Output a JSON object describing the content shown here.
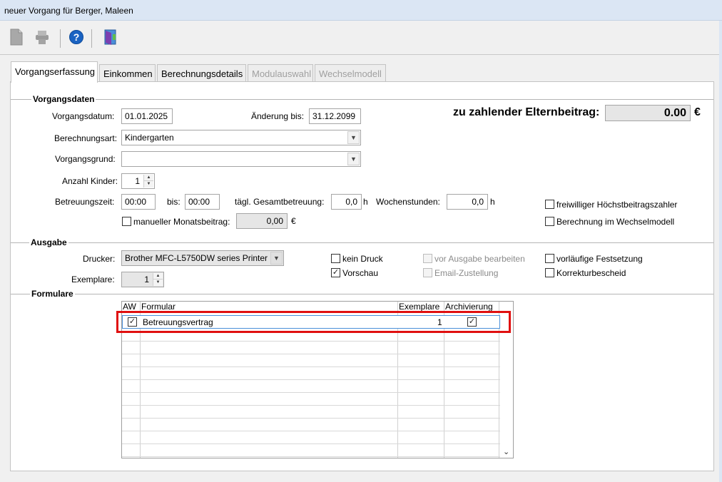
{
  "window": {
    "title": "neuer Vorgang für Berger, Maleen"
  },
  "toolbar": {
    "icons": [
      "new-document-icon",
      "print-icon",
      "help-icon",
      "exit-door-icon"
    ],
    "help_glyph": "?"
  },
  "tabs": [
    {
      "label": "Vorgangserfassung",
      "state": "active"
    },
    {
      "label": "Einkommen",
      "state": "normal"
    },
    {
      "label": "Berechnungsdetails",
      "state": "normal"
    },
    {
      "label": "Modulauswahl",
      "state": "disabled"
    },
    {
      "label": "Wechselmodell",
      "state": "disabled"
    }
  ],
  "vorgangsdaten": {
    "section_title": "Vorgangsdaten",
    "vorgangsdatum_label": "Vorgangsdatum:",
    "vorgangsdatum_value": "01.01.2025",
    "aenderung_label": "Änderung bis:",
    "aenderung_value": "31.12.2099",
    "beitrag_label": "zu zahlender Elternbeitrag:",
    "beitrag_value": "0.00",
    "beitrag_currency": "€",
    "berechnungsart_label": "Berechnungsart:",
    "berechnungsart_value": "Kindergarten",
    "vorgangsgrund_label": "Vorgangsgrund:",
    "vorgangsgrund_value": "",
    "anzahl_kinder_label": "Anzahl Kinder:",
    "anzahl_kinder_value": "1",
    "betreuungszeit_label": "Betreuungszeit:",
    "betreuungszeit_from": "00:00",
    "bis_label": "bis:",
    "betreuungszeit_to": "00:00",
    "gesamtbetreuung_label": "tägl. Gesamtbetreuung:",
    "gesamtbetreuung_value": "0,0",
    "gesamtbetreuung_unit": "h",
    "wochenstunden_label": "Wochenstunden:",
    "wochenstunden_value": "0,0",
    "wochenstunden_unit": "h",
    "hoechstbeitrag_label": "freiwilliger Höchstbeitragszahler",
    "hoechstbeitrag_checked": false,
    "manueller_label": "manueller Monatsbeitrag:",
    "manueller_checked": false,
    "manueller_value": "0,00",
    "manueller_currency": "€",
    "wechselmodell_label": "Berechnung im Wechselmodell",
    "wechselmodell_checked": false
  },
  "ausgabe": {
    "section_title": "Ausgabe",
    "drucker_label": "Drucker:",
    "drucker_value": "Brother MFC-L5750DW series Printer",
    "exemplare_label": "Exemplare:",
    "exemplare_value": "1",
    "kein_druck_label": "kein Druck",
    "kein_druck_checked": false,
    "vorschau_label": "Vorschau",
    "vorschau_checked": true,
    "vor_ausgabe_label": "vor Ausgabe bearbeiten",
    "vor_ausgabe_checked": false,
    "email_label": "Email-Zustellung",
    "email_checked": false,
    "vorlaeufige_label": "vorläufige Festsetzung",
    "vorlaeufige_checked": false,
    "korrektur_label": "Korrekturbescheid",
    "korrektur_checked": false
  },
  "formulare": {
    "section_title": "Formulare",
    "columns": [
      "AW",
      "Formular",
      "Exemplare",
      "Archivierung"
    ],
    "rows": [
      {
        "aw": true,
        "formular": "Betreuungsvertrag",
        "exemplare": "1",
        "archivierung": true
      }
    ],
    "check_glyph": "✓",
    "scroll_down_glyph": "⌄"
  },
  "colors": {
    "highlight": "#e01010",
    "accent": "#1a63c2"
  }
}
